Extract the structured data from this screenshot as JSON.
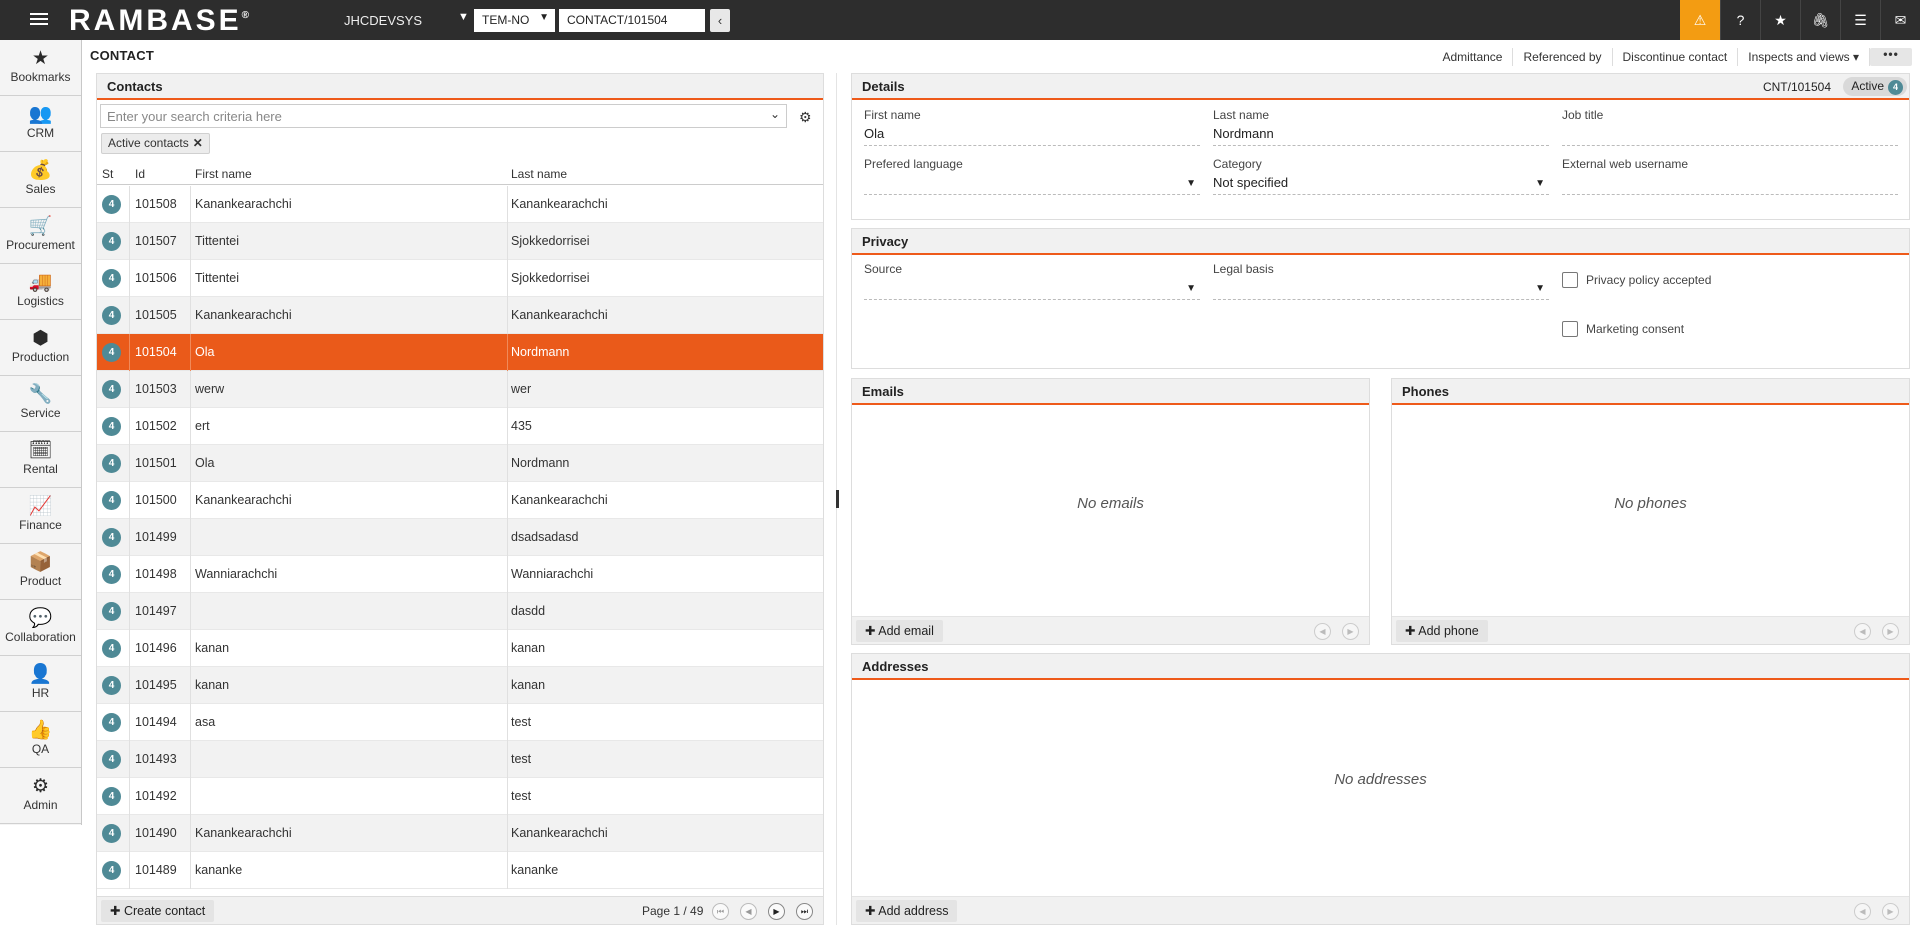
{
  "topbar": {
    "logo": "RAMBASE",
    "logo_mark": "®",
    "system": "JHCDEVSYS",
    "company": "TEM-NO",
    "object_input": "CONTACT/101504",
    "back": "‹",
    "icons": [
      "warning-icon",
      "help-icon",
      "star-icon",
      "paperclip-icon",
      "list-icon",
      "mail-icon"
    ],
    "accent": "#f39c12"
  },
  "sidebar": {
    "items": [
      {
        "label": "Bookmarks",
        "icon": "★"
      },
      {
        "label": "CRM",
        "icon": "👥"
      },
      {
        "label": "Sales",
        "icon": "💰"
      },
      {
        "label": "Procurement",
        "icon": "🛒"
      },
      {
        "label": "Logistics",
        "icon": "🚚"
      },
      {
        "label": "Production",
        "icon": "⬢"
      },
      {
        "label": "Service",
        "icon": "🔧"
      },
      {
        "label": "Rental",
        "icon": "🗓"
      },
      {
        "label": "Finance",
        "icon": "📈"
      },
      {
        "label": "Product",
        "icon": "📦"
      },
      {
        "label": "Collaboration",
        "icon": "💬"
      },
      {
        "label": "HR",
        "icon": "👤"
      },
      {
        "label": "QA",
        "icon": "👍"
      },
      {
        "label": "Admin",
        "icon": "⚙"
      }
    ]
  },
  "page": {
    "title": "CONTACT",
    "actions": [
      "Admittance",
      "Referenced by",
      "Discontinue contact",
      "Inspects and views ▾"
    ],
    "more": "•••"
  },
  "contacts": {
    "title": "Contacts",
    "search_placeholder": "Enter your search criteria here",
    "filter_chip": "Active contacts",
    "columns": [
      "St",
      "Id",
      "First name",
      "Last name"
    ],
    "rows": [
      {
        "st": "4",
        "id": "101508",
        "first": "Kanankearachchi",
        "last": "Kanankearachchi"
      },
      {
        "st": "4",
        "id": "101507",
        "first": "Tittentei",
        "last": "Sjokkedorrisei"
      },
      {
        "st": "4",
        "id": "101506",
        "first": "Tittentei",
        "last": "Sjokkedorrisei"
      },
      {
        "st": "4",
        "id": "101505",
        "first": "Kanankearachchi",
        "last": "Kanankearachchi"
      },
      {
        "st": "4",
        "id": "101504",
        "first": "Ola",
        "last": "Nordmann"
      },
      {
        "st": "4",
        "id": "101503",
        "first": "werw",
        "last": "wer"
      },
      {
        "st": "4",
        "id": "101502",
        "first": "ert",
        "last": "435"
      },
      {
        "st": "4",
        "id": "101501",
        "first": "Ola",
        "last": "Nordmann"
      },
      {
        "st": "4",
        "id": "101500",
        "first": "Kanankearachchi",
        "last": "Kanankearachchi"
      },
      {
        "st": "4",
        "id": "101499",
        "first": "",
        "last": "dsadsadasd"
      },
      {
        "st": "4",
        "id": "101498",
        "first": "Wanniarachchi",
        "last": "Wanniarachchi"
      },
      {
        "st": "4",
        "id": "101497",
        "first": "",
        "last": "dasdd"
      },
      {
        "st": "4",
        "id": "101496",
        "first": "kanan",
        "last": "kanan"
      },
      {
        "st": "4",
        "id": "101495",
        "first": "kanan",
        "last": "kanan"
      },
      {
        "st": "4",
        "id": "101494",
        "first": "asa",
        "last": "test"
      },
      {
        "st": "4",
        "id": "101493",
        "first": "",
        "last": "test"
      },
      {
        "st": "4",
        "id": "101492",
        "first": "",
        "last": "test"
      },
      {
        "st": "4",
        "id": "101490",
        "first": "Kanankearachchi",
        "last": "Kanankearachchi"
      },
      {
        "st": "4",
        "id": "101489",
        "first": "kananke",
        "last": "kananke"
      }
    ],
    "selected_id": "101504",
    "create_label": "Create contact",
    "page_info": "Page 1 / 49",
    "selected_color": "#ea5a1a"
  },
  "details": {
    "title": "Details",
    "cnt_id": "CNT/101504",
    "status": "Active",
    "status_num": "4",
    "first_name_label": "First name",
    "first_name": "Ola",
    "last_name_label": "Last name",
    "last_name": "Nordmann",
    "job_title_label": "Job title",
    "job_title": "",
    "language_label": "Prefered language",
    "language": "",
    "category_label": "Category",
    "category": "Not specified",
    "web_user_label": "External web username",
    "web_user": ""
  },
  "privacy": {
    "title": "Privacy",
    "source_label": "Source",
    "source": "",
    "legal_label": "Legal basis",
    "legal": "",
    "policy_label": "Privacy policy accepted",
    "marketing_label": "Marketing consent"
  },
  "emails": {
    "title": "Emails",
    "empty": "No emails",
    "add": "Add email"
  },
  "phones": {
    "title": "Phones",
    "empty": "No phones",
    "add": "Add phone"
  },
  "addresses": {
    "title": "Addresses",
    "empty": "No addresses",
    "add": "Add address"
  }
}
